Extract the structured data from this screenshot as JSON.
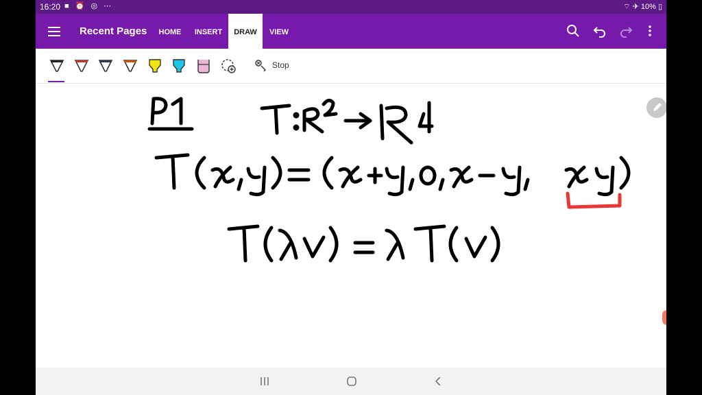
{
  "status_bar": {
    "time": "16:20",
    "battery": "10%"
  },
  "app_bar": {
    "title": "Recent Pages",
    "tabs": [
      {
        "label": "HOME",
        "active": false
      },
      {
        "label": "INSERT",
        "active": false
      },
      {
        "label": "DRAW",
        "active": true
      },
      {
        "label": "VIEW",
        "active": false
      }
    ]
  },
  "ribbon": {
    "pens": [
      {
        "name": "pen-black",
        "color": "#222222"
      },
      {
        "name": "pen-red",
        "color": "#c0392b"
      },
      {
        "name": "pen-dark",
        "color": "#2c3e50"
      },
      {
        "name": "pen-orange",
        "color": "#d35400"
      },
      {
        "name": "highlighter-yellow",
        "color": "#f1e40f"
      },
      {
        "name": "highlighter-cyan",
        "color": "#1ec6e6"
      },
      {
        "name": "highlighter-pink",
        "color": "#e9b6d8"
      }
    ],
    "stop_label": "Stop"
  },
  "colors": {
    "accent": "#7719aa",
    "status_bar": "#5d1a86",
    "ink": "#000000",
    "annotation": "#e53935"
  }
}
